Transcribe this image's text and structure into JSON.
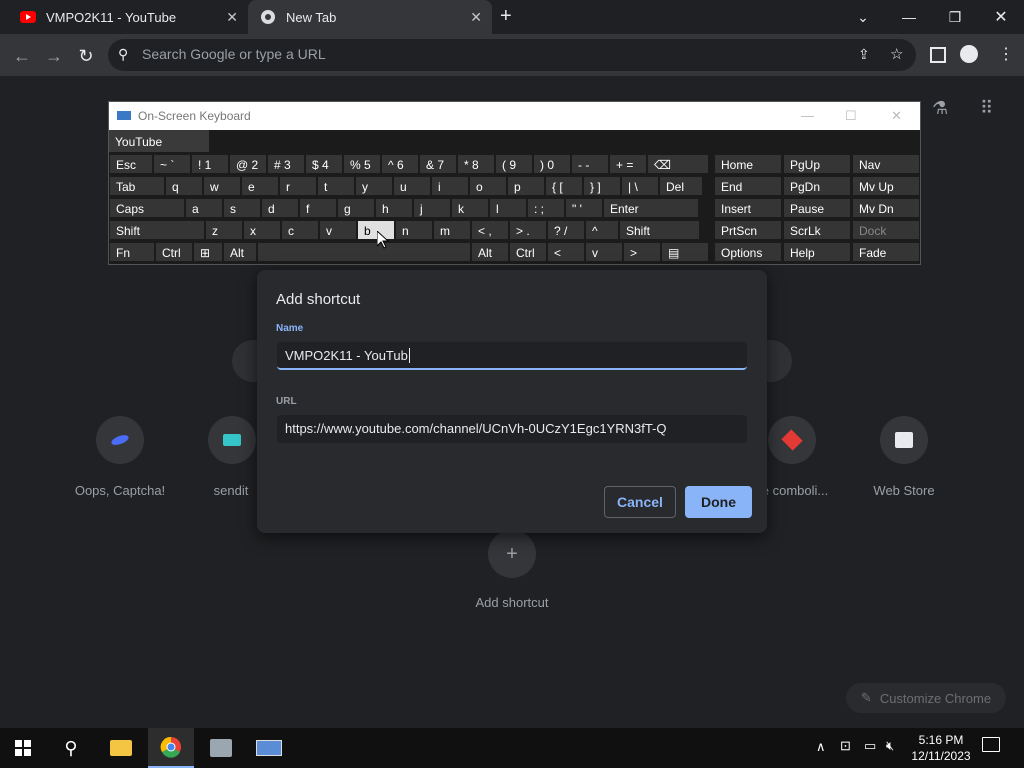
{
  "browser": {
    "tabs": [
      {
        "title": "VMPO2K11 - YouTube"
      },
      {
        "title": "New Tab"
      }
    ],
    "new_tab": "+",
    "omnibox_placeholder": "Search Google or type a URL"
  },
  "ntp": {
    "tiles": [
      {
        "label": "Oops, Captcha!"
      },
      {
        "label": "sendit"
      },
      {
        "label": "e comboli..."
      },
      {
        "label": "Web Store"
      }
    ],
    "add_shortcut_label": "Add shortcut",
    "customize_label": "Customize Chrome"
  },
  "osk": {
    "title": "On-Screen Keyboard",
    "prediction": "YouTube",
    "rows": [
      [
        {
          "k": "Esc",
          "w": 44
        },
        {
          "k": "1",
          "s": "~ `",
          "w": 38
        },
        {
          "k": "1",
          "s": "!",
          "w": 38
        },
        {
          "k": "2",
          "s": "@",
          "w": 38
        },
        {
          "k": "3",
          "s": "#",
          "w": 38
        },
        {
          "k": "4",
          "s": "$",
          "w": 38
        },
        {
          "k": "5",
          "s": "%",
          "w": 38
        },
        {
          "k": "6",
          "s": "^",
          "w": 38
        },
        {
          "k": "7",
          "s": "&",
          "w": 38
        },
        {
          "k": "8",
          "s": "*",
          "w": 38
        },
        {
          "k": "9",
          "s": "(",
          "w": 38
        },
        {
          "k": "0",
          "s": ")",
          "w": 38
        },
        {
          "k": "-",
          "s": "-",
          "w": 38
        },
        {
          "k": "=",
          "s": "+",
          "w": 38
        },
        {
          "k": "⌫",
          "w": 62
        }
      ]
    ],
    "row1": [
      "Esc",
      "~ `",
      "! 1",
      "@ 2",
      "# 3",
      "$ 4",
      "% 5",
      "^ 6",
      "& 7",
      "* 8",
      "( 9",
      ") 0",
      "- -",
      "+ =",
      "⌫"
    ],
    "row2": [
      "Tab",
      "q",
      "w",
      "e",
      "r",
      "t",
      "y",
      "u",
      "i",
      "o",
      "p",
      "{ [",
      "} ]",
      "| \\",
      "Del"
    ],
    "row3": [
      "Caps",
      "a",
      "s",
      "d",
      "f",
      "g",
      "h",
      "j",
      "k",
      "l",
      ": ;",
      "\" '",
      "Enter"
    ],
    "row4": [
      "Shift",
      "z",
      "x",
      "c",
      "v",
      "b",
      "n",
      "m",
      "< ,",
      "> .",
      "? /",
      "^",
      "Shift"
    ],
    "row5": [
      "Fn",
      "Ctrl",
      "⊞",
      "Alt",
      "",
      "Alt",
      "Ctrl",
      "<",
      "v",
      ">",
      "▤"
    ],
    "side": [
      [
        "Home",
        "PgUp",
        "Nav"
      ],
      [
        "End",
        "PgDn",
        "Mv Up"
      ],
      [
        "Insert",
        "Pause",
        "Mv Dn"
      ],
      [
        "PrtScn",
        "ScrLk",
        "Dock"
      ],
      [
        "Options",
        "Help",
        "Fade"
      ]
    ]
  },
  "dialog": {
    "title": "Add shortcut",
    "name_label": "Name",
    "name_value": "VMPO2K11 - YouTub",
    "url_label": "URL",
    "url_value": "https://www.youtube.com/channel/UCnVh-0UCzY1Egc1YRN3fT-Q",
    "cancel": "Cancel",
    "done": "Done"
  },
  "taskbar": {
    "time": "5:16 PM",
    "date": "12/11/2023"
  },
  "colors": {
    "accent": "#8ab4f8",
    "dialog_bg": "#292a2d",
    "page_bg": "#202124"
  }
}
